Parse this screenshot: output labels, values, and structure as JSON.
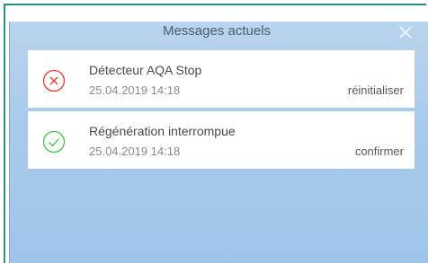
{
  "dialog": {
    "title": "Messages actuels",
    "close_icon": "close-icon"
  },
  "messages": [
    {
      "status": "error",
      "icon": "error-circle-x-icon",
      "icon_color": "#e53935",
      "title": "Détecteur AQA Stop",
      "timestamp": "25.04.2019 14:18",
      "action": "réinitialiser"
    },
    {
      "status": "ok",
      "icon": "check-circle-icon",
      "icon_color": "#43c443",
      "title": "Régénération interrompue",
      "timestamp": "25.04.2019 14:18",
      "action": "confirmer"
    }
  ]
}
